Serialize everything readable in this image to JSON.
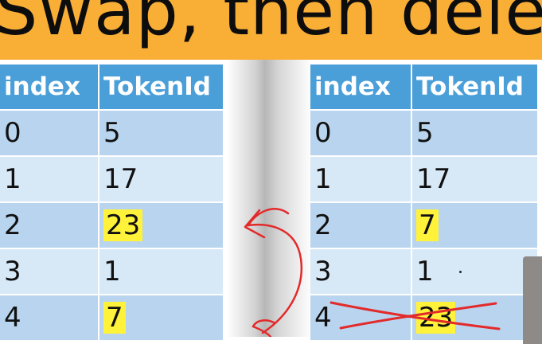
{
  "title": "Swap, then delet",
  "left_table": {
    "headers": [
      "index",
      "TokenId"
    ],
    "rows": [
      {
        "index": "0",
        "token": "5"
      },
      {
        "index": "1",
        "token": "17"
      },
      {
        "index": "2",
        "token": "23"
      },
      {
        "index": "3",
        "token": "1"
      },
      {
        "index": "4",
        "token": "7"
      }
    ]
  },
  "right_table": {
    "headers": [
      "index",
      "TokenId"
    ],
    "rows": [
      {
        "index": "0",
        "token": "5"
      },
      {
        "index": "1",
        "token": "17"
      },
      {
        "index": "2",
        "token": "7"
      },
      {
        "index": "3",
        "token": "1"
      },
      {
        "index": "4",
        "token": "23"
      }
    ]
  },
  "colors": {
    "banner": "#f9ae36",
    "header": "#4a9fd9",
    "row_light": "#d7e8f7",
    "row_dark": "#b8d4ef",
    "highlight": "#fff23a",
    "annotation": "#e32a2a"
  }
}
